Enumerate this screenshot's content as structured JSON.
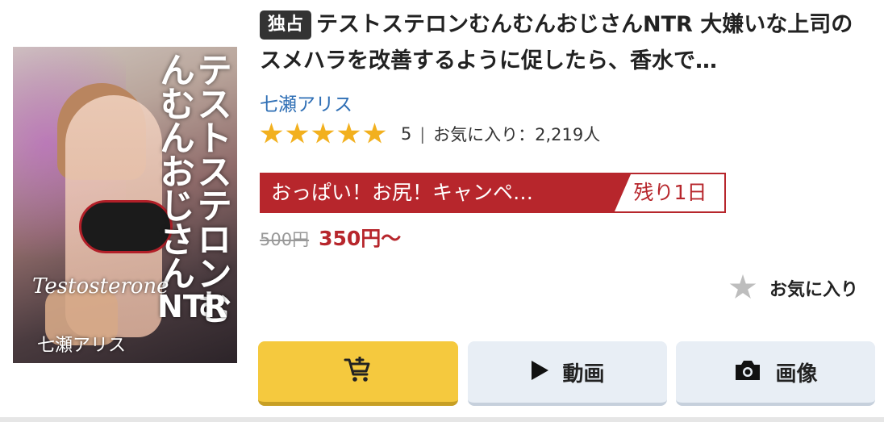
{
  "product": {
    "badge": "独占",
    "title": "テストステロンむんむんおじさんNTR 大嫌いな上司のスメハラを改善するように促したら、香水で…",
    "actress": "七瀬アリス",
    "rating_value": "5",
    "rating_stars": 5,
    "favorites_text": "お気に入り：2,219人"
  },
  "cover": {
    "title_vertical": "テストステロンむんむんおじさん",
    "title_latin": "Testosterone",
    "title_ntr": "NTR",
    "cast_name": "七瀬アリス"
  },
  "campaign": {
    "name": "おっぱい！お尻！キャンペ…",
    "remaining": "残り1日",
    "color": "#b7262c"
  },
  "pricing": {
    "original": "500円",
    "sale": "350円〜"
  },
  "favorite_toggle": {
    "label": "お気に入り",
    "icon": "star-icon"
  },
  "actions": {
    "cart_icon": "cart-plus-icon",
    "movie_label": "動画",
    "movie_icon": "play-icon",
    "image_label": "画像",
    "image_icon": "camera-icon"
  },
  "colors": {
    "accent_yellow": "#f5c93e",
    "star": "#f2b01e",
    "link": "#2f6fb5",
    "secondary_button": "#e8eef5"
  }
}
